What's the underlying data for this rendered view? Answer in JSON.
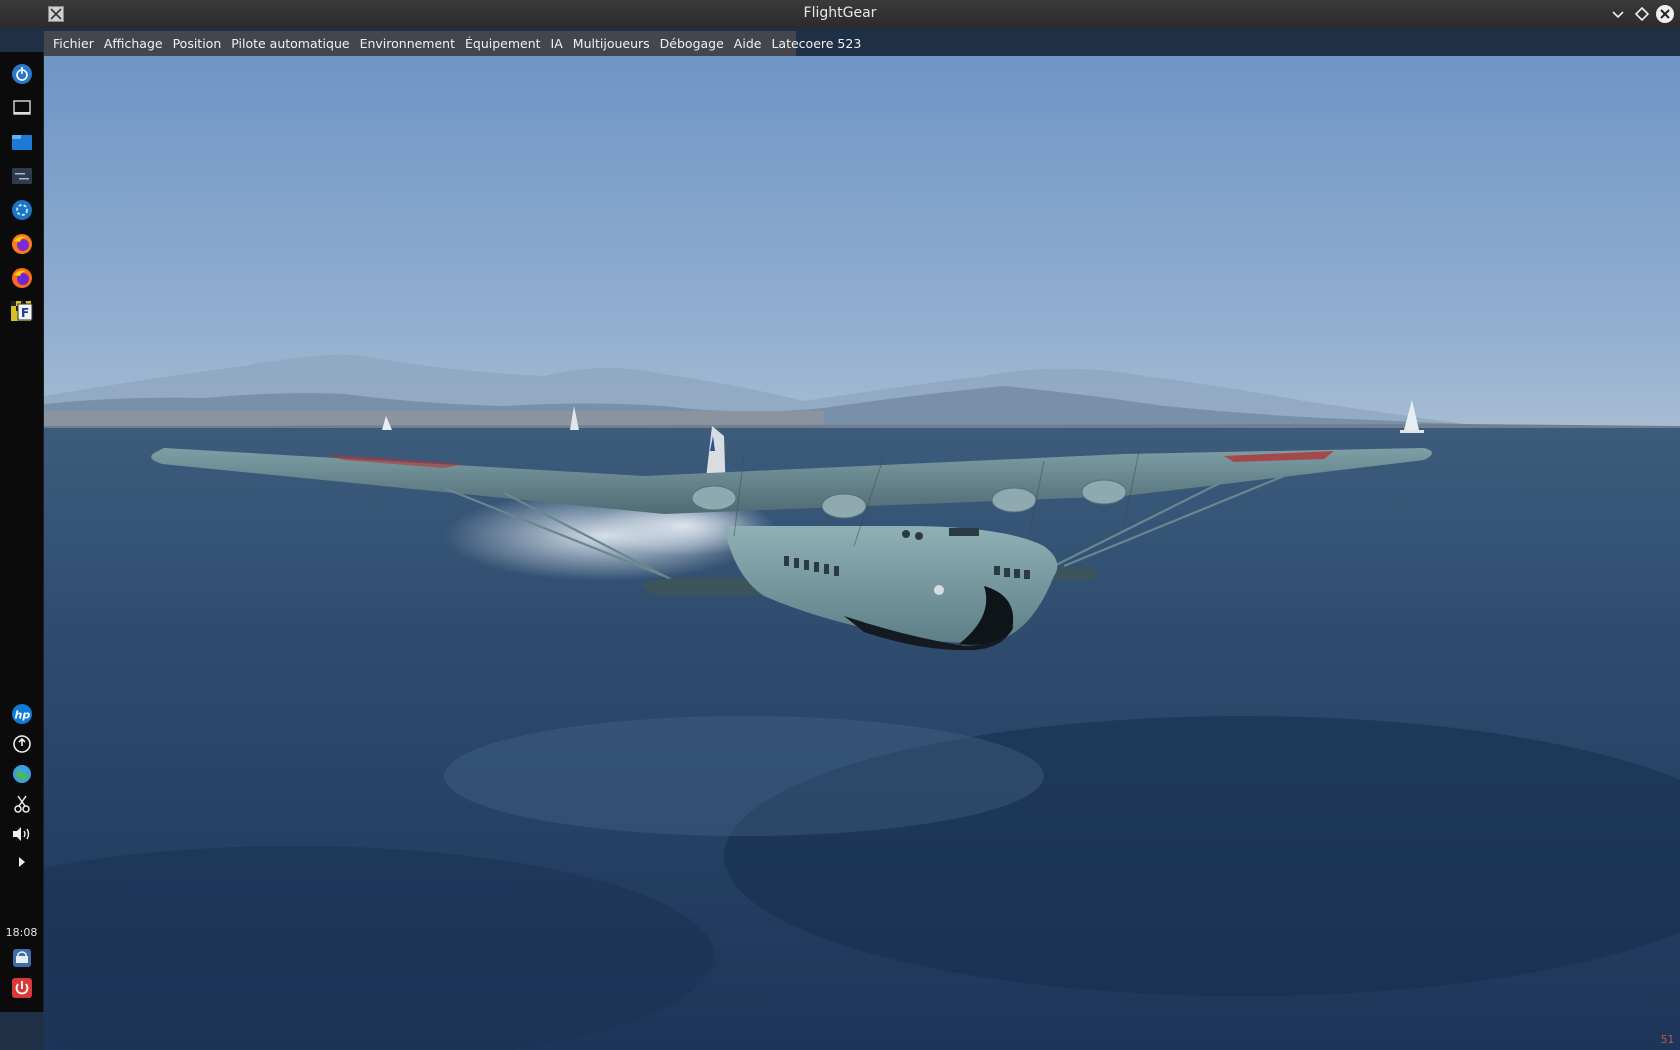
{
  "window": {
    "title": "FlightGear"
  },
  "menubar": {
    "items": [
      {
        "label": "Fichier"
      },
      {
        "label": "Affichage"
      },
      {
        "label": "Position"
      },
      {
        "label": "Pilote automatique"
      },
      {
        "label": "Environnement"
      },
      {
        "label": "Équipement"
      },
      {
        "label": "IA"
      },
      {
        "label": "Multijoueurs"
      },
      {
        "label": "Débogage"
      },
      {
        "label": "Aide"
      },
      {
        "label": "Latecoere 523"
      }
    ]
  },
  "panel": {
    "launchers": [
      {
        "icon": "kde-launcher-icon"
      },
      {
        "icon": "show-desktop-icon"
      },
      {
        "icon": "file-manager-icon"
      },
      {
        "icon": "system-settings-icon"
      },
      {
        "icon": "discover-icon"
      },
      {
        "icon": "firefox-icon"
      },
      {
        "icon": "firefox-icon"
      },
      {
        "icon": "flightgear-icon"
      }
    ],
    "tray": [
      {
        "icon": "hp-icon"
      },
      {
        "icon": "update-icon"
      },
      {
        "icon": "network-globe-icon"
      },
      {
        "icon": "scissors-icon"
      },
      {
        "icon": "volume-icon"
      },
      {
        "icon": "expand-tray-icon"
      }
    ],
    "clock": "18:08",
    "bottom": [
      {
        "icon": "lock-screen-icon"
      },
      {
        "icon": "power-icon"
      }
    ]
  },
  "scene": {
    "fps": "51"
  },
  "colors": {
    "sky_top": "#6f95c6",
    "sky_horizon": "#a9bfd2",
    "sea": "#2a4566",
    "aircraft": "#6f9098",
    "menubar": "#46484e",
    "fps_text": "#c0564a"
  }
}
